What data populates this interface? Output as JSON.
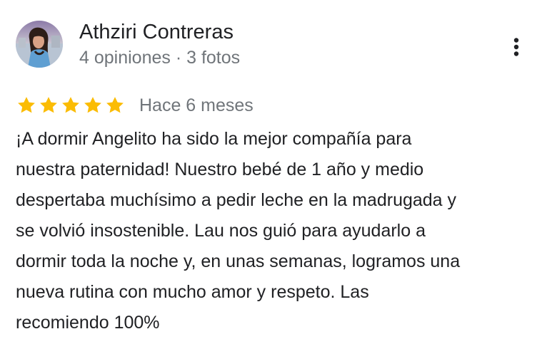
{
  "reviewer": {
    "name": "Athziri Contreras",
    "meta": "4 opiniones · 3 fotos",
    "avatar_icon": "profile-photo"
  },
  "menu": {
    "icon": "more-vertical-icon"
  },
  "review": {
    "rating": 5,
    "rating_max": 5,
    "star_color": "#fbbc04",
    "date": "Hace 6 meses",
    "text": "¡A dormir Angelito ha sido la mejor compañía para\nnuestra paternidad! Nuestro bebé de 1 año y medio\ndespertaba muchísimo a pedir leche en la madrugada y\nse volvió insostenible. Lau nos guió para ayudarlo a\ndormir toda la noche y, en unas semanas, logramos una\nnueva rutina con mucho amor y respeto. Las\nrecomiendo 100%"
  }
}
